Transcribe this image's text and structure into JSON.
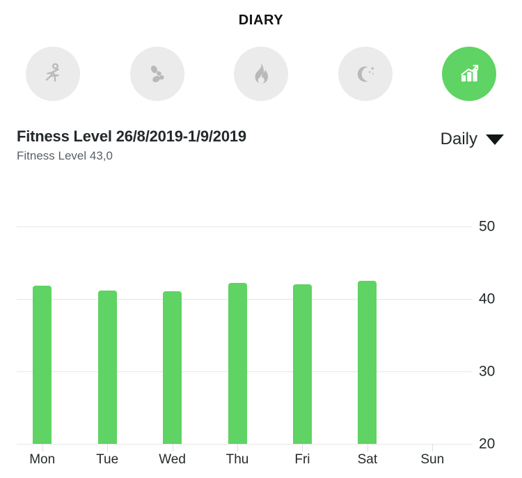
{
  "header": {
    "title": "DIARY"
  },
  "tabs": [
    {
      "name": "activity",
      "icon": "running-person-icon",
      "active": false
    },
    {
      "name": "steps",
      "icon": "footsteps-icon",
      "active": false
    },
    {
      "name": "calories",
      "icon": "flame-icon",
      "active": false
    },
    {
      "name": "sleep",
      "icon": "moon-stars-icon",
      "active": false
    },
    {
      "name": "fitness-level",
      "icon": "bar-chart-arrow-icon",
      "active": true
    }
  ],
  "section": {
    "title": "Fitness Level 26/8/2019-1/9/2019",
    "subtitle": "Fitness Level 43,0",
    "period_label": "Daily",
    "caret_icon": "chevron-down-icon"
  },
  "colors": {
    "accent": "#5fd363",
    "bar": "#5fd363",
    "inactive_tab_bg": "#ebebeb",
    "inactive_tab_icon": "#b9b9b9",
    "grid": "#e6e6e6",
    "text": "#24292b"
  },
  "chart_data": {
    "type": "bar",
    "title": "Fitness Level 26/8/2019-1/9/2019",
    "subtitle": "Fitness Level 43,0",
    "xlabel": "",
    "ylabel": "",
    "categories": [
      "Mon",
      "Tue",
      "Wed",
      "Thu",
      "Fri",
      "Sat",
      "Sun"
    ],
    "values": [
      41.8,
      41.2,
      41.1,
      42.2,
      42.0,
      42.5,
      null
    ],
    "ylim": [
      20,
      50
    ],
    "yticks": [
      20,
      30,
      40,
      50
    ],
    "grid": true,
    "legend": "none",
    "series_name": "Fitness Level",
    "bar_color": "#5fd363"
  }
}
